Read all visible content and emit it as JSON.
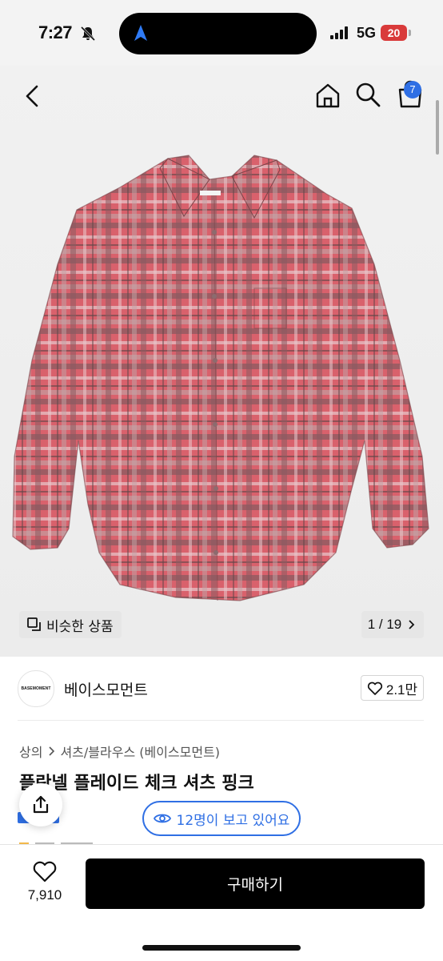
{
  "status_bar": {
    "time": "7:27",
    "network": "5G",
    "battery": "20"
  },
  "header": {
    "cart_count": "7"
  },
  "gallery": {
    "similar_label": "비슷한 상품",
    "page_indicator": "1 / 19",
    "shirt_color": "#d9616c"
  },
  "brand": {
    "logo_text": "BASEMOMENT",
    "name": "베이스모먼트",
    "likes": "2.1만"
  },
  "breadcrumb": [
    "상의",
    "셔츠/블라우스 (베이스모먼트)"
  ],
  "product": {
    "title": "플란넬 플레이드 체크 셔츠 핑크"
  },
  "viewers_label": "12명이 보고 있어요",
  "bottom": {
    "like_count": "7,910",
    "buy_label": "구매하기"
  },
  "colors": {
    "accent": "#2f6fe4",
    "buy_button": "#000000"
  }
}
